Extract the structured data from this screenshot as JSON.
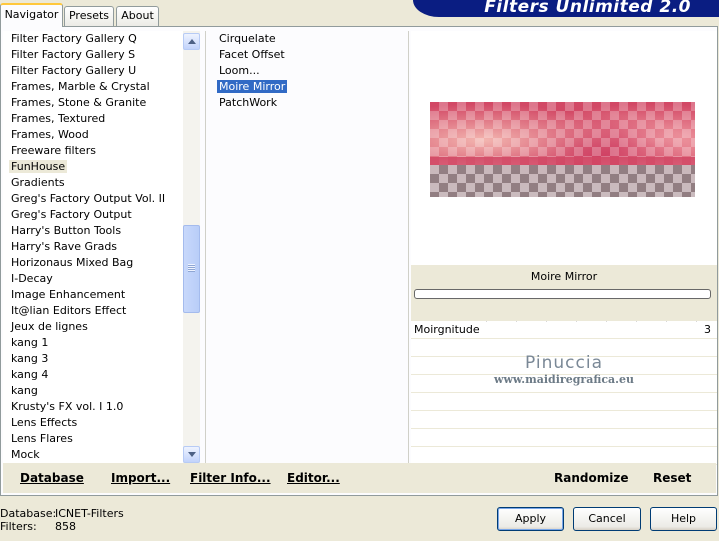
{
  "tabs": [
    {
      "label": "Navigator",
      "active": true
    },
    {
      "label": "Presets",
      "active": false
    },
    {
      "label": "About",
      "active": false
    }
  ],
  "banner": {
    "title": "Filters Unlimited 2.0",
    "color": "#0a1d82"
  },
  "categories": [
    "Filter Factory Gallery Q",
    "Filter Factory Gallery S",
    "Filter Factory Gallery U",
    "Frames, Marble & Crystal",
    "Frames, Stone & Granite",
    "Frames, Textured",
    "Frames, Wood",
    "Freeware filters",
    "FunHouse",
    "Gradients",
    "Greg's Factory Output Vol. II",
    "Greg's Factory Output",
    "Harry's Button Tools",
    "Harry's Rave Grads",
    "Horizonaus Mixed Bag",
    "I-Decay",
    "Image Enhancement",
    "It@lian Editors Effect",
    "Jeux de lignes",
    "kang 1",
    "kang 3",
    "kang 4",
    "kang",
    "Krusty's FX vol. I 1.0",
    "Lens Effects",
    "Lens Flares",
    "Mock"
  ],
  "selected_category": "FunHouse",
  "filters": [
    "Cirquelate",
    "Facet Offset",
    "Loom...",
    "Moire Mirror",
    "PatchWork"
  ],
  "selected_filter": "Moire Mirror",
  "preview": {
    "filter_name": "Moire Mirror",
    "progress": 0
  },
  "params": [
    {
      "label": "Moirgnitude",
      "value": "3"
    }
  ],
  "watermark": {
    "name": "Pinuccia",
    "url": "www.maidiregrafica.eu"
  },
  "actions": {
    "database": "Database",
    "import": "Import...",
    "filter_info": "Filter Info...",
    "editor": "Editor...",
    "randomize": "Randomize",
    "reset": "Reset"
  },
  "status": {
    "database_label": "Database:",
    "database_value": "ICNET-Filters",
    "filters_label": "Filters:",
    "filters_value": "858"
  },
  "buttons": {
    "apply": "Apply",
    "cancel": "Cancel",
    "help": "Help"
  },
  "colors": {
    "selection": "#316ac5",
    "background": "#ece9d8"
  }
}
